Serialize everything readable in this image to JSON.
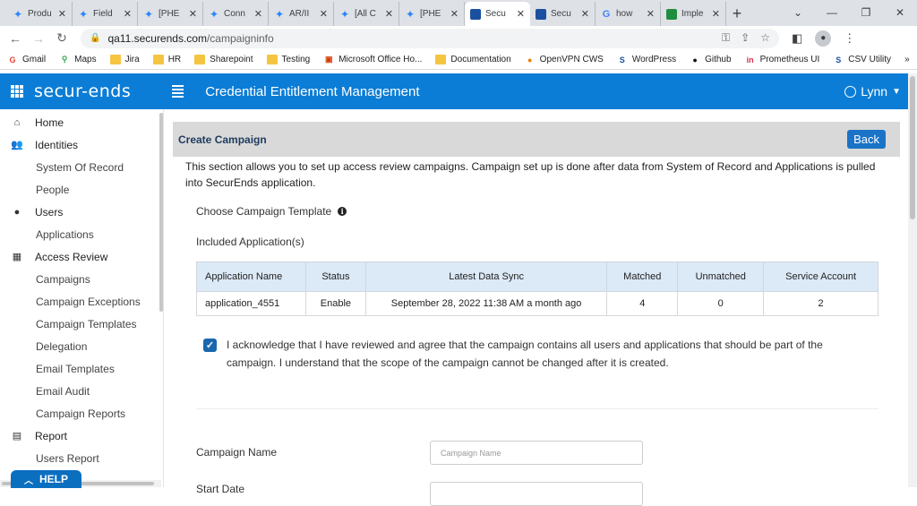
{
  "browser": {
    "tabs": [
      {
        "title": "Produ",
        "icon": "jira-icon"
      },
      {
        "title": "Field",
        "icon": "jira-icon"
      },
      {
        "title": "[PHE",
        "icon": "jira-icon"
      },
      {
        "title": "Conn",
        "icon": "jira-icon"
      },
      {
        "title": "AR/II",
        "icon": "jira-icon"
      },
      {
        "title": "[All C",
        "icon": "jira-icon"
      },
      {
        "title": "[PHE",
        "icon": "jira-icon"
      },
      {
        "title": "Secu",
        "icon": "securends-icon",
        "active": true
      },
      {
        "title": "Secu",
        "icon": "securends-icon"
      },
      {
        "title": "how",
        "icon": "google-icon"
      },
      {
        "title": "Imple",
        "icon": "app-icon"
      }
    ],
    "url_host": "qa11.securends.com",
    "url_path": "/campaigninfo",
    "bookmarks": [
      "Gmail",
      "Maps",
      "Jira",
      "HR",
      "Sharepoint",
      "Testing",
      "Microsoft Office Ho...",
      "Documentation",
      "OpenVPN CWS",
      "WordPress",
      "Github",
      "Prometheus UI",
      "CSV Utility"
    ],
    "bookmarks_more": "»"
  },
  "app": {
    "logo": "secur-ends",
    "title": "Credential Entitlement Management",
    "user": "Lynn"
  },
  "sidebar": {
    "items": [
      {
        "label": "Home",
        "type": "section",
        "icon": "home-icon"
      },
      {
        "label": "Identities",
        "type": "section",
        "icon": "people-icon"
      },
      {
        "label": "System Of Record",
        "type": "sub"
      },
      {
        "label": "People",
        "type": "sub"
      },
      {
        "label": "Users",
        "type": "section",
        "icon": "user-icon"
      },
      {
        "label": "Applications",
        "type": "sub"
      },
      {
        "label": "Access Review",
        "type": "section",
        "icon": "grid-icon"
      },
      {
        "label": "Campaigns",
        "type": "sub"
      },
      {
        "label": "Campaign Exceptions",
        "type": "sub"
      },
      {
        "label": "Campaign Templates",
        "type": "sub"
      },
      {
        "label": "Delegation",
        "type": "sub"
      },
      {
        "label": "Email Templates",
        "type": "sub"
      },
      {
        "label": "Email Audit",
        "type": "sub"
      },
      {
        "label": "Campaign Reports",
        "type": "sub"
      },
      {
        "label": "Report",
        "type": "section",
        "icon": "report-icon"
      },
      {
        "label": "Users Report",
        "type": "sub"
      }
    ],
    "help_label": "HELP"
  },
  "main": {
    "heading": "Create Campaign",
    "back_label": "Back",
    "description": "This section allows you to set up access review campaigns. Campaign set up is done after data from System of Record and Applications is pulled into SecurEnds application.",
    "template_label": "Choose Campaign Template",
    "included_label": "Included Application(s)",
    "table": {
      "headers": [
        "Application Name",
        "Status",
        "Latest Data Sync",
        "Matched",
        "Unmatched",
        "Service Account"
      ],
      "rows": [
        [
          "application_4551",
          "Enable",
          "September 28, 2022 11:38 AM a month ago",
          "4",
          "0",
          "2"
        ]
      ]
    },
    "ack_text": "I acknowledge that I have reviewed and agree that the campaign contains all users and applications that should be part of the campaign. I understand that the scope of the campaign cannot be changed after it is created.",
    "campaign_name_label": "Campaign Name",
    "campaign_name_placeholder": "Campaign Name",
    "start_date_label": "Start Date"
  }
}
